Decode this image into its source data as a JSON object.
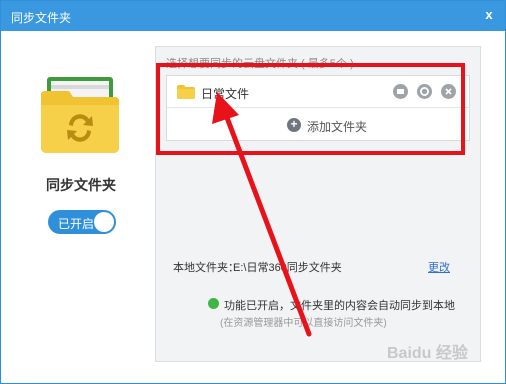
{
  "window": {
    "title": "同步文件夹",
    "close_glyph": "x"
  },
  "left": {
    "title": "同步文件夹",
    "toggle_label": "已开启"
  },
  "panel": {
    "hint": "选择想要同步的云盘文件夹 ( 最多5个 )",
    "folders": [
      {
        "name": "日常文件"
      }
    ],
    "add_label": "添加文件夹",
    "local_label": "本地文件夹：",
    "local_path": "E:\\日常360同步文件夹",
    "change_link": "更改",
    "status_text": "功能已开启，文件夹里的内容会自动同步到本地",
    "status_sub": "(在资源管理器中可以直接访问文件夹)"
  },
  "watermark": "Baidu 经验",
  "colors": {
    "titlebar": "#3a98e0",
    "annotation": "#e8121a",
    "toggle": "#2f8fd8",
    "link": "#2f6fcf",
    "status_ok": "#3fb545"
  }
}
